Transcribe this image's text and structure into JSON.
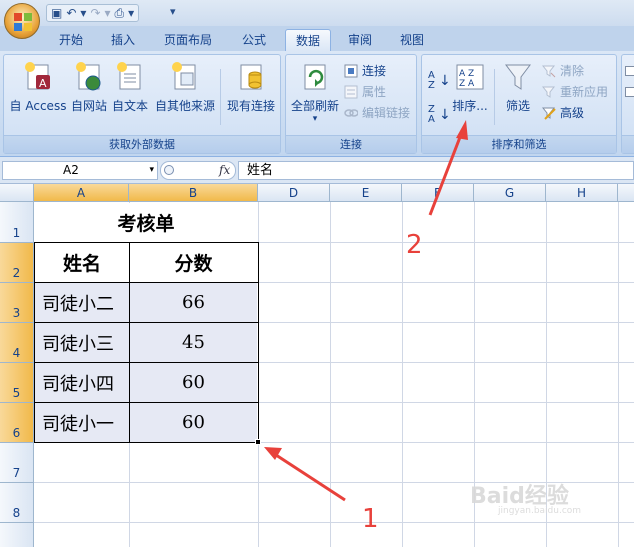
{
  "quick_access": {
    "dropdown_glyph": "▾"
  },
  "tabs": [
    {
      "label": "开始"
    },
    {
      "label": "插入"
    },
    {
      "label": "页面布局"
    },
    {
      "label": "公式"
    },
    {
      "label": "数据",
      "active": true
    },
    {
      "label": "审阅"
    },
    {
      "label": "视图"
    }
  ],
  "ribbon": {
    "external_data": {
      "label": "获取外部数据",
      "buttons": [
        "自 Access",
        "自网站",
        "自文本",
        "自其他来源",
        "现有连接"
      ]
    },
    "connections": {
      "label": "连接",
      "refresh_all": "全部刷新",
      "connections": "连接",
      "properties": "属性",
      "edit_links": "编辑链接"
    },
    "sort_filter": {
      "label": "排序和筛选",
      "sort": "排序...",
      "filter": "筛选",
      "clear": "清除",
      "reapply": "重新应用",
      "advanced": "高级"
    }
  },
  "formula_bar": {
    "name_box": "A2",
    "fx": "fx",
    "content": "姓名"
  },
  "columns": [
    "A",
    "B",
    "D",
    "E",
    "F",
    "G",
    "H"
  ],
  "rows": [
    "1",
    "2",
    "3",
    "4",
    "5",
    "6",
    "7",
    "8"
  ],
  "sheet": {
    "title": "考核单",
    "headers": [
      "姓名",
      "分数"
    ],
    "data": [
      {
        "name": "司徒小二",
        "score": "66"
      },
      {
        "name": "司徒小三",
        "score": "45"
      },
      {
        "name": "司徒小四",
        "score": "60"
      },
      {
        "name": "司徒小一",
        "score": "60"
      }
    ]
  },
  "annotations": {
    "label_1": "1",
    "label_2": "2",
    "color": "#e8413b"
  },
  "watermark": {
    "text": "Baid经验",
    "sub": "jingyan.baidu.com"
  }
}
